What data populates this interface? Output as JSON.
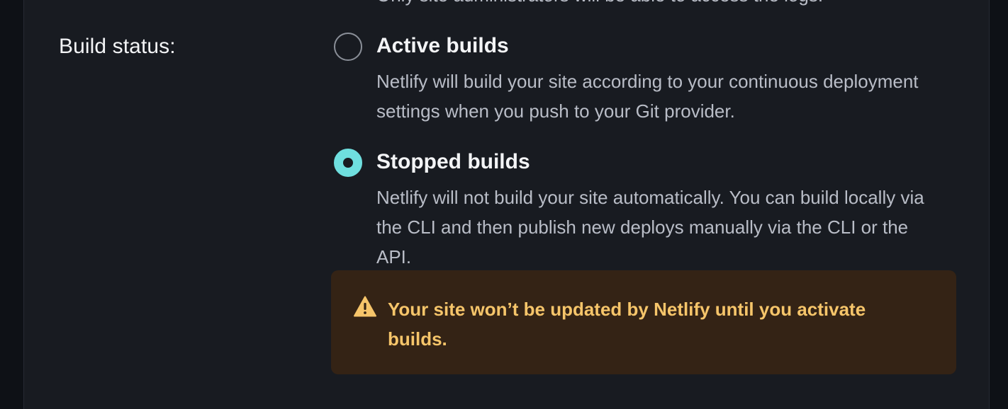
{
  "top_partial_text": "Only site administrators will be able to access the logs.",
  "build_status": {
    "label": "Build status:",
    "options": [
      {
        "id": "active",
        "title": "Active builds",
        "description": "Netlify will build your site according to your continuous deployment settings when you push to your Git provider.",
        "selected": false
      },
      {
        "id": "stopped",
        "title": "Stopped builds",
        "description": "Netlify will not build your site automatically. You can build locally via the CLI and then publish new deploys manually via the CLI or the API.",
        "selected": true
      }
    ],
    "warning": {
      "icon": "warning-triangle-icon",
      "text": "Your site won’t be updated by Netlify until you activate builds."
    }
  },
  "colors": {
    "page_background": "#0e1116",
    "card_background": "#181b21",
    "accent_teal": "#6fdfdf",
    "warning_background": "#342315",
    "warning_text": "#f6c56a"
  }
}
